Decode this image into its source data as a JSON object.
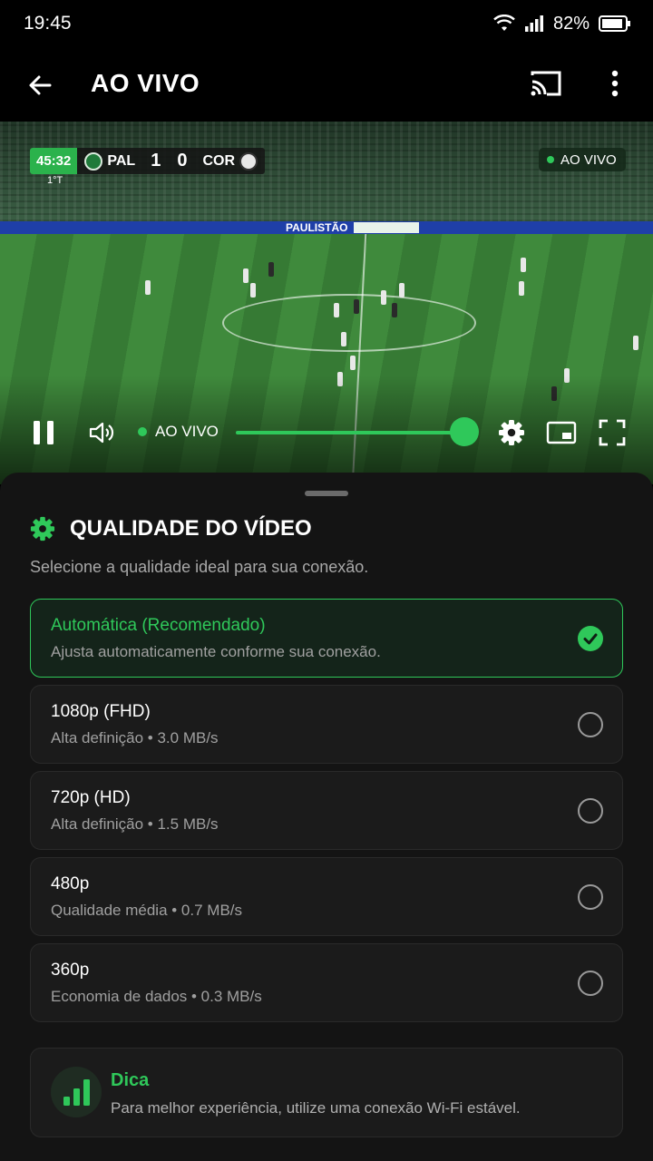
{
  "status_bar": {
    "time": "19:45",
    "battery_pct": "82%"
  },
  "app_bar": {
    "title": "AO VIVO"
  },
  "player": {
    "scoreboard": {
      "clock": "45:32",
      "period": "1°T",
      "home_team": "PAL",
      "home_score": "1",
      "away_score": "0",
      "away_team": "COR"
    },
    "live_badge": "AO VIVO",
    "board_text": "PAULISTÃO",
    "controls": {
      "live_label": "AO VIVO",
      "progress": 1.0
    }
  },
  "quality_sheet": {
    "title": "QUALIDADE DO VÍDEO",
    "subtitle": "Selecione a qualidade ideal para sua conexão.",
    "options": [
      {
        "title": "Automática (Recomendado)",
        "desc": "Ajusta automaticamente conforme sua conexão.",
        "selected": true
      },
      {
        "title": "1080p (FHD)",
        "desc": "Alta definição  •  3.0 MB/s",
        "selected": false
      },
      {
        "title": "720p (HD)",
        "desc": "Alta definição  •  1.5 MB/s",
        "selected": false
      },
      {
        "title": "480p",
        "desc": "Qualidade média  •  0.7 MB/s",
        "selected": false
      },
      {
        "title": "360p",
        "desc": "Economia de dados  •  0.3 MB/s",
        "selected": false
      }
    ],
    "tip": {
      "title": "Dica",
      "text": "Para melhor experiência, utilize uma conexão Wi-Fi estável."
    }
  },
  "colors": {
    "accent": "#2fc85a",
    "background": "#000000",
    "sheet": "#141414"
  }
}
